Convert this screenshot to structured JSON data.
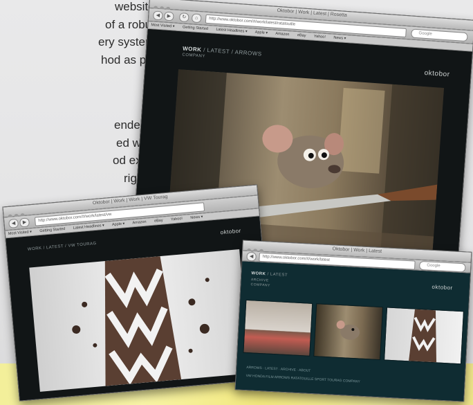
{
  "intro_text": {
    "paragraph1_lines": [
      "website project",
      "of a robust",
      "ery system – in",
      "hod as possible."
    ],
    "paragraph2_lines": [
      "ended to us by a",
      "ed with them in",
      "od experience, so",
      "right people for"
    ]
  },
  "main_window": {
    "title": "Oktobor | Work | Latest | Rosetta",
    "url": "http://www.oktobor.com/#/work/latest/ratatouille",
    "search_placeholder": "Google",
    "bookmarks": [
      "Most Visited ▾",
      "Getting Started",
      "Latest Headlines ▾",
      "Apple ▾",
      "Amazon",
      "eBay",
      "Yahoo!",
      "News ▾"
    ],
    "breadcrumb_work": "WORK",
    "breadcrumb_rest": "/ LATEST / ARROWS",
    "breadcrumb_sub": "COMPANY",
    "logo": "oktobor"
  },
  "left_window": {
    "title": "Oktobor | Work | Work | VW Tourag",
    "url": "http://www.oktobor.com/#/work/latest/vw",
    "bookmarks": [
      "Most Visited ▾",
      "Getting Started",
      "Latest Headlines ▾",
      "Apple ▾",
      "Amazon",
      "eBay",
      "Yahoo!",
      "News ▾"
    ],
    "breadcrumb": "WORK / LATEST / VW TOURAG",
    "logo": "oktobor"
  },
  "right_window": {
    "title": "Oktobor | Work | Latest",
    "url": "http://www.oktobor.com/#/work/latest",
    "search_placeholder": "Google",
    "breadcrumb_work": "WORK",
    "breadcrumb_rest": "/ LATEST",
    "nav_sub1": "ARCHIVE",
    "nav_sub2": "COMPANY",
    "logo": "oktobor",
    "strip_row1": "ARROWS · LATEST · ARCHIVE · ABOUT",
    "strip_row2": "VW   HONDA   FILM   ARROWS   RATATOUILLE   SPORT   TOURAG   COMPANY"
  }
}
